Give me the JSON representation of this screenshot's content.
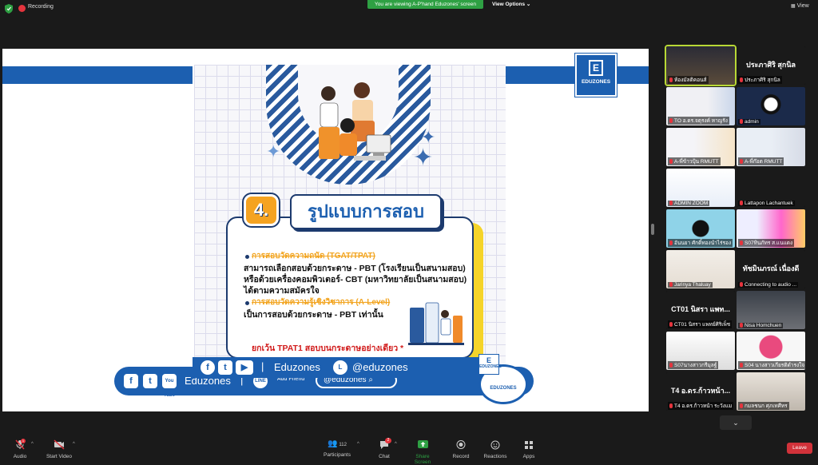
{
  "topbar": {
    "recording_label": "Recording",
    "viewing_banner": "You are viewing A-P'hand Eduzones' screen",
    "view_options_label": "View Options",
    "view_label": "View"
  },
  "share": {
    "logo_mark": "E",
    "logo_name": "EDUZONES",
    "poster": {
      "badge_number": "4.",
      "title": "รูปแบบการสอบ",
      "heading1": "การสอบวัดความถนัด (TGAT/TPAT)",
      "line1": "สามารถเลือกสอบด้วยกระดาษ - PBT (โรงเรียนเป็นสนามสอบ)",
      "line2": "หรือด้วยเครื่องคอมพิวเตอร์- CBT (มหาวิทยาลัยเป็นสนามสอบ)",
      "line3": "ได้ตามความสมัครใจ",
      "heading2": "การสอบวัดความรู้เชิงวิชาการ (A-Level)",
      "line4": "เป็นการสอบด้วยกระดาษ - PBT เท่านั้น",
      "note": "ยกเว้น TPAT1 สอบบนกระดาษอย่างเดียว *"
    },
    "social_top": {
      "brand": "Eduzones",
      "line_id": "@eduzones"
    },
    "social_bottom": {
      "youtube_icon_text": "You Tube",
      "brand": "Eduzones",
      "add_friend": "Add Friend",
      "line_id": "@eduzones"
    },
    "mini_logo": "EDUZONES",
    "circle_logo": "EDUZONES"
  },
  "gallery": [
    {
      "name": "ห้องมัลติคอนส์",
      "big": ""
    },
    {
      "name": "ประภาศิริ สุกนิล",
      "big": "ประภาศิริ สุกนิล"
    },
    {
      "name": "TO อ.ดร.จตุรงค์ หาญรัง",
      "big": ""
    },
    {
      "name": "admin",
      "big": ""
    },
    {
      "name": "A-พี่ข้าวปุ้น RMUTT",
      "big": ""
    },
    {
      "name": "A-พี่ก๊อต RMUTT",
      "big": ""
    },
    {
      "name": "ADMIN ZOOM",
      "big": ""
    },
    {
      "name": "Lattapon Lachantuek",
      "big": ""
    },
    {
      "name": "อันนยา ศักดิ์ทองนำไร่รอง",
      "big": ""
    },
    {
      "name": "S07ทินภัทร ส.แนแดง",
      "big": ""
    },
    {
      "name": "Jarinya Thaluay",
      "big": ""
    },
    {
      "name": "Connecting to audio ...",
      "big": "ทัชมินภรณ์ เนื่องดี"
    },
    {
      "name": "CT01 นิสรา แพทย์ศิริเพ็ช",
      "big": "CT01 นิสรา แพท..."
    },
    {
      "name": "Nisa Homchuen",
      "big": ""
    },
    {
      "name": "S07นางสาวกรีมุลฐ์",
      "big": ""
    },
    {
      "name": "S04 นางสาวเกียรติดำรงใจ",
      "big": ""
    },
    {
      "name": "T4 อ.ดร.ก้าวหน้า ระวังแม",
      "big": "T4 อ.ดร.ก้าวหน้า..."
    },
    {
      "name": "กมลชนก ศุภเทศีทร",
      "big": ""
    }
  ],
  "toolbar": {
    "audio": "Audio",
    "start_video": "Start Video",
    "participants": "Participants",
    "participants_count": "112",
    "chat": "Chat",
    "chat_badge": "2",
    "share_screen": "Share Screen",
    "record": "Record",
    "reactions": "Reactions",
    "apps": "Apps",
    "leave": "Leave",
    "audio_badge": "1"
  },
  "colors": {
    "brand_blue": "#1c5fb0",
    "accent_orange": "#f5a321",
    "share_green": "#2ea043",
    "leave_red": "#d1323a"
  }
}
